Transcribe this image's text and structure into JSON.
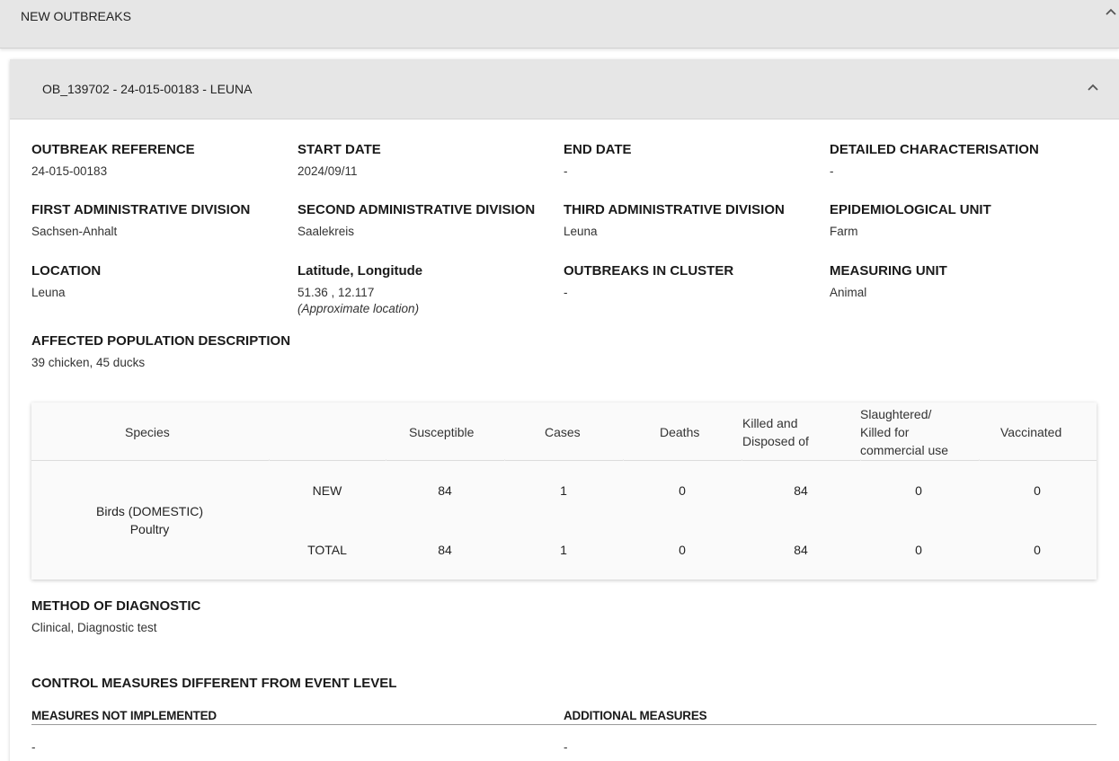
{
  "top_section": {
    "title": "NEW OUTBREAKS"
  },
  "outbreak": {
    "header": "OB_139702 - 24-015-00183 - LEUNA",
    "fields": [
      {
        "label": "OUTBREAK REFERENCE",
        "value": "24-015-00183"
      },
      {
        "label": "START DATE",
        "value": "2024/09/11"
      },
      {
        "label": "END DATE",
        "value": "-"
      },
      {
        "label": "DETAILED CHARACTERISATION",
        "value": "-"
      },
      {
        "label": "FIRST ADMINISTRATIVE DIVISION",
        "value": "Sachsen-Anhalt"
      },
      {
        "label": "SECOND ADMINISTRATIVE DIVISION",
        "value": "Saalekreis"
      },
      {
        "label": "THIRD ADMINISTRATIVE DIVISION",
        "value": "Leuna"
      },
      {
        "label": "EPIDEMIOLOGICAL UNIT",
        "value": "Farm"
      },
      {
        "label": "LOCATION",
        "value": "Leuna"
      },
      {
        "label": "Latitude, Longitude",
        "value": "51.36 , 12.117",
        "note": "(Approximate location)"
      },
      {
        "label": "OUTBREAKS IN CLUSTER",
        "value": "-"
      },
      {
        "label": "MEASURING UNIT",
        "value": "Animal"
      },
      {
        "label": "AFFECTED POPULATION DESCRIPTION",
        "value": "39 chicken, 45 ducks"
      }
    ],
    "table": {
      "headers": {
        "species": "Species",
        "susceptible": "Susceptible",
        "cases": "Cases",
        "deaths": "Deaths",
        "killed_l1": "Killed and",
        "killed_l2": "Disposed of",
        "slaughtered_l1": "Slaughtered/",
        "slaughtered_l2": "Killed for",
        "slaughtered_l3": "commercial use",
        "vaccinated": "Vaccinated"
      },
      "species_l1": "Birds (DOMESTIC)",
      "species_l2": "Poultry",
      "rows": [
        {
          "type": "NEW",
          "susceptible": "84",
          "cases": "1",
          "deaths": "0",
          "killed": "84",
          "slaughtered": "0",
          "vaccinated": "0"
        },
        {
          "type": "TOTAL",
          "susceptible": "84",
          "cases": "1",
          "deaths": "0",
          "killed": "84",
          "slaughtered": "0",
          "vaccinated": "0"
        }
      ]
    },
    "method": {
      "label": "METHOD OF DIAGNOSTIC",
      "value": "Clinical, Diagnostic test"
    },
    "control": {
      "title": "CONTROL MEASURES DIFFERENT FROM EVENT LEVEL",
      "not_implemented_label": "MEASURES NOT IMPLEMENTED",
      "not_implemented_value": "-",
      "additional_label": "ADDITIONAL MEASURES",
      "additional_value": "-"
    }
  },
  "icons": {
    "collapse": "chevron-up-icon"
  }
}
